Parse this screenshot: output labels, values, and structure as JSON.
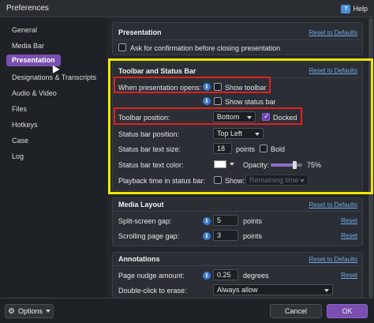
{
  "window": {
    "title": "Preferences",
    "help_label": "Help",
    "help_icon": "?"
  },
  "sidebar": {
    "items": [
      {
        "label": "General"
      },
      {
        "label": "Media Bar"
      },
      {
        "label": "Presentation"
      },
      {
        "label": "Designations & Transcripts"
      },
      {
        "label": "Audio & Video"
      },
      {
        "label": "Files"
      },
      {
        "label": "Hotkeys"
      },
      {
        "label": "Case"
      },
      {
        "label": "Log"
      }
    ],
    "active": "Presentation"
  },
  "presentation": {
    "title": "Presentation",
    "reset": "Reset to Defaults",
    "ask_confirm": "Ask for confirmation before closing presentation"
  },
  "toolbar_status": {
    "title": "Toolbar and Status Bar",
    "reset": "Reset to Defaults",
    "when_opens_label": "When presentation opens:",
    "show_toolbar": "Show toolbar",
    "show_status_bar": "Show status bar",
    "toolbar_position_label": "Toolbar position:",
    "toolbar_position_value": "Bottom",
    "docked_label": "Docked",
    "status_bar_position_label": "Status bar position:",
    "status_bar_position_value": "Top Left",
    "status_text_size_label": "Status bar text size:",
    "status_text_size_value": "18",
    "points_label": "points",
    "bold_label": "Bold",
    "status_text_color_label": "Status bar text color:",
    "opacity_label": "Opacity:",
    "opacity_value": "75%",
    "opacity_level": 0.75,
    "playback_label": "Playback time in status bar:",
    "show_label": "Show:",
    "show_value": "Remaining time"
  },
  "media_layout": {
    "title": "Media Layout",
    "reset": "Reset to Defaults",
    "split_gap_label": "Split-screen gap:",
    "split_gap_value": "5",
    "scroll_gap_label": "Scrolling page gap:",
    "scroll_gap_value": "3",
    "points_label": "points",
    "reset_small": "Reset"
  },
  "annotations": {
    "title": "Annotations",
    "reset": "Reset to Defaults",
    "nudge_label": "Page nudge amount:",
    "nudge_value": "0.25",
    "degrees_label": "degrees",
    "double_click_label": "Double-click to erase:",
    "double_click_value": "Always allow",
    "reset_small": "Reset"
  },
  "footer": {
    "options_label": "Options",
    "cancel_label": "Cancel",
    "ok_label": "OK"
  },
  "info_icon_glyph": "i",
  "colors": {
    "accent": "#7a4fb0",
    "link": "#6fa8e8",
    "highlight_yellow": "#f2e600",
    "highlight_red": "#e02020"
  }
}
